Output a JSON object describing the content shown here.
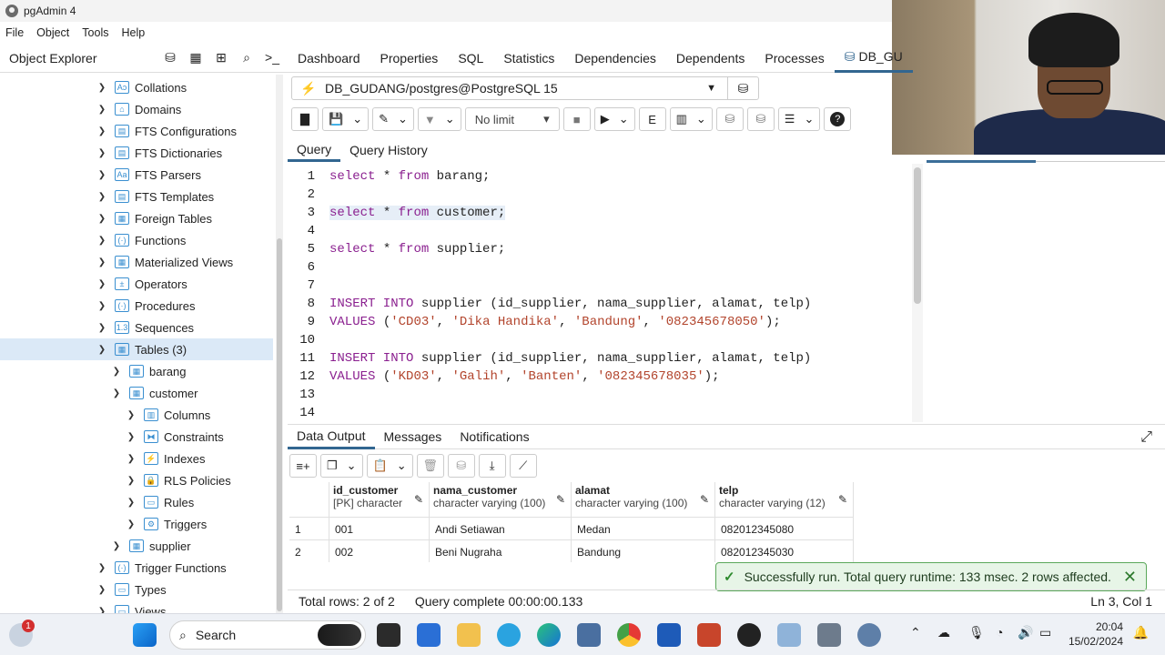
{
  "window": {
    "title": "pgAdmin 4"
  },
  "menu": [
    "File",
    "Object",
    "Tools",
    "Help"
  ],
  "explorer": {
    "title": "Object Explorer",
    "tools": [
      "database-icon",
      "table-icon",
      "tree-icon",
      "search-icon",
      "terminal-icon"
    ],
    "items": [
      {
        "label": "Collations",
        "icon": "Aↄ"
      },
      {
        "label": "Domains",
        "icon": "⌂"
      },
      {
        "label": "FTS Configurations",
        "icon": "▤"
      },
      {
        "label": "FTS Dictionaries",
        "icon": "▤"
      },
      {
        "label": "FTS Parsers",
        "icon": "Aa"
      },
      {
        "label": "FTS Templates",
        "icon": "▤"
      },
      {
        "label": "Foreign Tables",
        "icon": "▦"
      },
      {
        "label": "Functions",
        "icon": "(·)"
      },
      {
        "label": "Materialized Views",
        "icon": "▦"
      },
      {
        "label": "Operators",
        "icon": "±"
      },
      {
        "label": "Procedures",
        "icon": "(·)"
      },
      {
        "label": "Sequences",
        "icon": "1.3"
      },
      {
        "label": "Tables (3)",
        "icon": "▦"
      },
      {
        "label": "barang",
        "icon": "▦"
      },
      {
        "label": "customer",
        "icon": "▦"
      },
      {
        "label": "Columns",
        "icon": "▥"
      },
      {
        "label": "Constraints",
        "icon": "⧓"
      },
      {
        "label": "Indexes",
        "icon": "⚡"
      },
      {
        "label": "RLS Policies",
        "icon": "🔒"
      },
      {
        "label": "Rules",
        "icon": "▭"
      },
      {
        "label": "Triggers",
        "icon": "⚙"
      },
      {
        "label": "supplier",
        "icon": "▦"
      },
      {
        "label": "Trigger Functions",
        "icon": "(·)"
      },
      {
        "label": "Types",
        "icon": "▭"
      },
      {
        "label": "Views",
        "icon": "▭"
      }
    ]
  },
  "tabs": [
    "Dashboard",
    "Properties",
    "SQL",
    "Statistics",
    "Dependencies",
    "Dependents",
    "Processes",
    "DB_GU"
  ],
  "connection": "DB_GUDANG/postgres@PostgreSQL 15",
  "toolbar": {
    "limit": "No limit"
  },
  "query_tabs": [
    "Query",
    "Query History"
  ],
  "editor": {
    "line_numbers": [
      "1",
      "2",
      "3",
      "4",
      "5",
      "6",
      "7",
      "8",
      "9",
      "10",
      "11",
      "12",
      "13",
      "14"
    ],
    "lines": [
      {
        "kw1": "select",
        "rest": " * ",
        "kw2": "from",
        "tail": " barang;"
      },
      {
        "kw1": "select",
        "rest": " * ",
        "kw2": "from",
        "tail": " customer;"
      },
      {
        "kw1": "select",
        "rest": " * ",
        "kw2": "from",
        "tail": " supplier;"
      }
    ],
    "insert1": {
      "a": "INSERT INTO",
      "b": " supplier (id_supplier, nama_supplier, alamat, telp)",
      "v": "VALUES",
      "p1": " (",
      "s1": "'CD03'",
      "s2": "'Dika Handika'",
      "s3": "'Bandung'",
      "s4": "'082345678050'",
      "end": ");"
    },
    "insert2": {
      "a": "INSERT INTO",
      "b": " supplier (id_supplier, nama_supplier, alamat, telp)",
      "v": "VALUES",
      "p1": " (",
      "s1": "'KD03'",
      "s2": "'Galih'",
      "s3": "'Banten'",
      "s4": "'082345678035'",
      "end": ");"
    },
    "sep": ", "
  },
  "output_tabs": [
    "Data Output",
    "Messages",
    "Notifications"
  ],
  "grid": {
    "columns": [
      {
        "name": "id_customer",
        "type": "[PK] character"
      },
      {
        "name": "nama_customer",
        "type": "character varying (100)"
      },
      {
        "name": "alamat",
        "type": "character varying (100)"
      },
      {
        "name": "telp",
        "type": "character varying (12)"
      }
    ],
    "rows": [
      {
        "n": "1",
        "cells": [
          "001",
          "Andi Setiawan",
          "Medan",
          "082012345080"
        ]
      },
      {
        "n": "2",
        "cells": [
          "002",
          "Beni Nugraha",
          "Bandung",
          "082012345030"
        ]
      }
    ]
  },
  "toast": "Successfully run. Total query runtime: 133 msec. 2 rows affected.",
  "status": {
    "total": "Total rows: 2 of 2",
    "complete": "Query complete 00:00:00.133",
    "pos": "Ln 3, Col 1"
  },
  "taskbar": {
    "search": "Search",
    "time": "20:04",
    "date": "15/02/2024",
    "badge": "1"
  },
  "colors": {
    "accent": "#326690",
    "keyword": "#8a1f8f",
    "string": "#b2442c",
    "toast_bg": "#e7f5e7"
  }
}
